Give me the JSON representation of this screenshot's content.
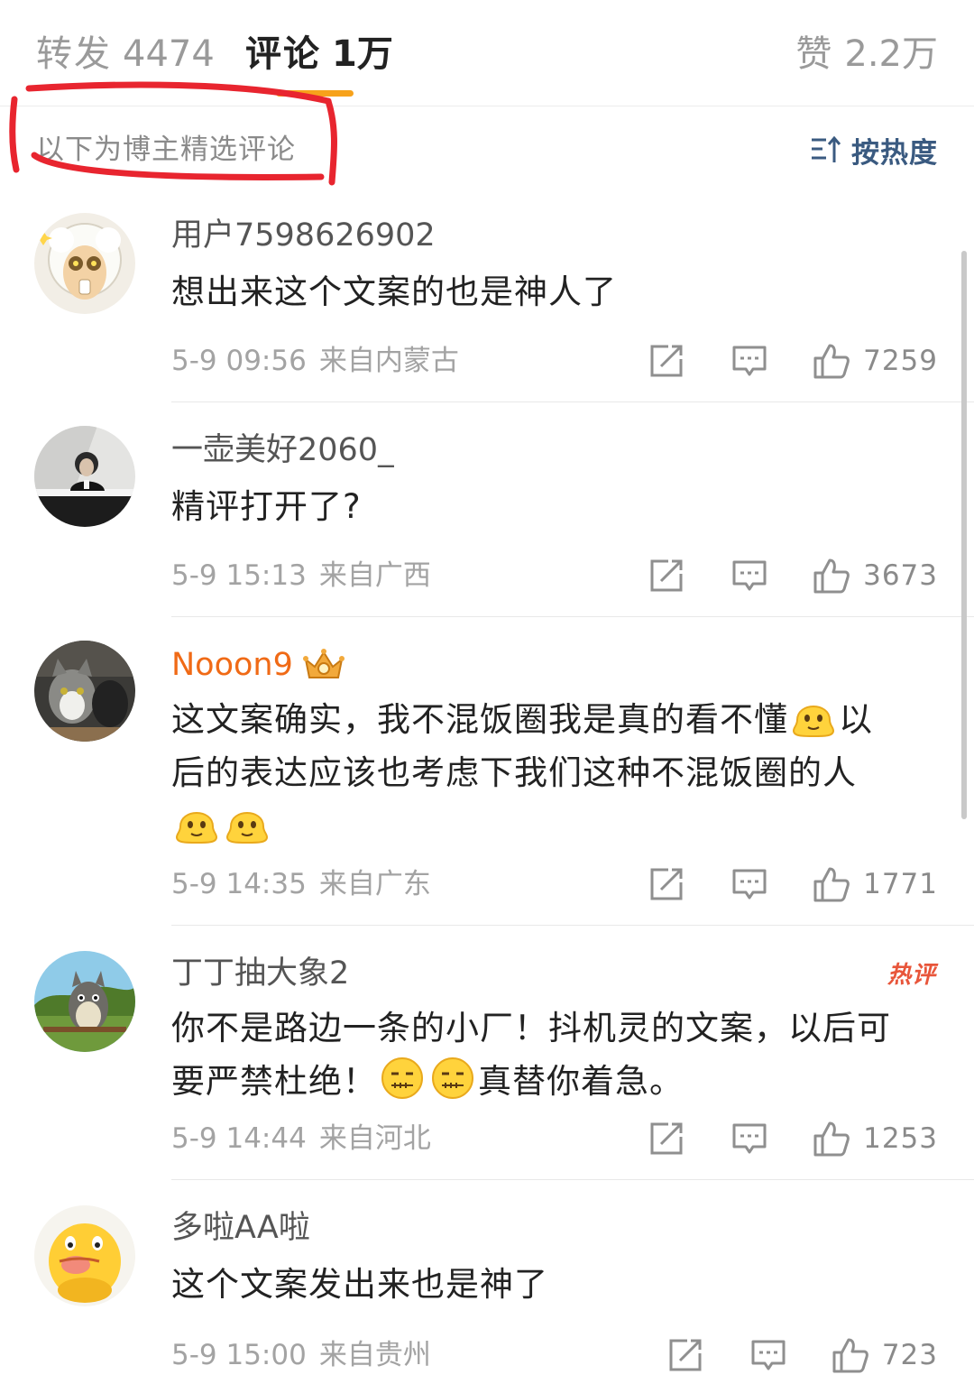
{
  "tabs": {
    "repost": {
      "label": "转发",
      "count": "4474"
    },
    "comment": {
      "label": "评论",
      "count": "1万"
    },
    "like": {
      "label": "赞",
      "count": "2.2万"
    }
  },
  "filter": {
    "label": "以下为博主精选评论",
    "sort_label": "按热度"
  },
  "colors": {
    "accent_underline": "#f7a21b",
    "annotation_red": "#e8252f",
    "vip_name": "#f06a16",
    "sort_link": "#3a5a80"
  },
  "comments": [
    {
      "user": "用户7598626902",
      "text": "想出来这个文案的也是神人了",
      "date": "5-9 09:56",
      "from": "来自内蒙古",
      "likes": "7259",
      "avatar_icon": "cartoon-sheep-avatar"
    },
    {
      "user": "一壶美好2060_",
      "text": "精评打开了?",
      "date": "5-9 15:13",
      "from": "来自广西",
      "likes": "3673",
      "avatar_icon": "pianist-photo-avatar"
    },
    {
      "user": "Nooon9",
      "text_line1": "这文案确实，我不混饭圈我是真的看不懂",
      "text_line1_end": "以",
      "text_line2": "后的表达应该也考虑下我们这种不混饭圈的人",
      "date": "5-9 14:35",
      "from": "来自广东",
      "likes": "1771",
      "badge_icon": "vip-crown-icon",
      "avatar_icon": "cat-photo-avatar",
      "emoji_icon": "melting-face-emoji"
    },
    {
      "user": "丁丁抽大象2",
      "hot_label": "热评",
      "text_line1": "你不是路边一条的小厂！抖机灵的文案，以后可",
      "text_line2": "要严禁杜绝！",
      "text_line2_end": "真替你着急。",
      "date": "5-9 14:44",
      "from": "来自河北",
      "likes": "1253",
      "avatar_icon": "totoro-avatar",
      "emoji_icon": "zipped-mouth-emoji"
    },
    {
      "user": "多啦AA啦",
      "text": "这个文案发出来也是神了",
      "date": "5-9 15:00",
      "from": "来自贵州",
      "likes": "723",
      "avatar_icon": "yellow-duck-avatar"
    }
  ],
  "action_icons": [
    "repost-icon",
    "reply-icon",
    "thumbs-up-icon"
  ]
}
